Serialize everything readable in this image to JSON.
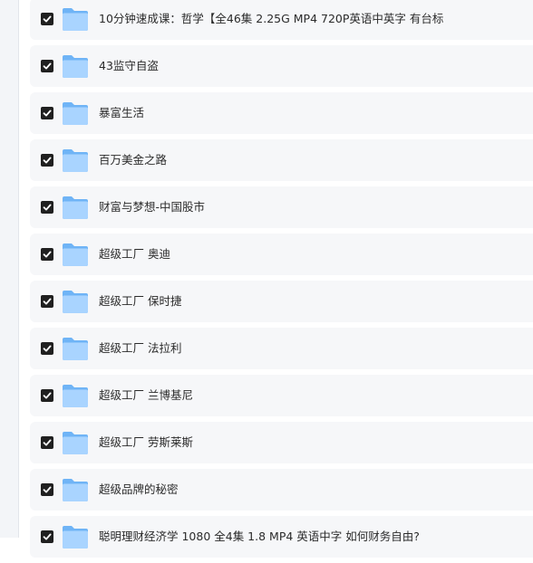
{
  "files": [
    {
      "name": "10分钟速成课：哲学【全46集 2.25G MP4 720P英语中英字 有台标",
      "checked": true
    },
    {
      "name": "43监守自盗",
      "checked": true
    },
    {
      "name": "暴富生活",
      "checked": true
    },
    {
      "name": "百万美金之路",
      "checked": true
    },
    {
      "name": "财富与梦想-中国股市",
      "checked": true
    },
    {
      "name": "超级工厂 奥迪",
      "checked": true
    },
    {
      "name": "超级工厂 保时捷",
      "checked": true
    },
    {
      "name": "超级工厂 法拉利",
      "checked": true
    },
    {
      "name": "超级工厂 兰博基尼",
      "checked": true
    },
    {
      "name": "超级工厂 劳斯莱斯",
      "checked": true
    },
    {
      "name": "超级品牌的秘密",
      "checked": true
    },
    {
      "name": "聪明理财经济学 1080 全4集 1.8 MP4 英语中字 如何财务自由?",
      "checked": true
    }
  ],
  "icons": {
    "checkbox": "check-icon",
    "folder": "folder-icon"
  },
  "colors": {
    "checkbox_fill": "#202020",
    "folder_light": "#a9d4ff",
    "folder_dark": "#6fb4f6",
    "row_background": "#f6f7f9"
  }
}
